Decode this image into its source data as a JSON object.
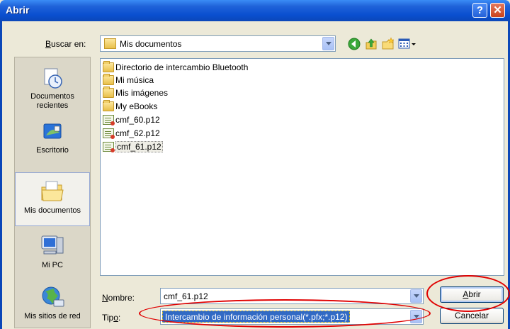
{
  "window": {
    "title": "Abrir",
    "help_glyph": "?",
    "close_glyph": "✕"
  },
  "look_in": {
    "label_prefix": "B",
    "label_rest": "uscar en:",
    "value": "Mis documentos"
  },
  "places": [
    {
      "label_line1": "Documentos",
      "label_line2": "recientes",
      "icon": "recent-documents-icon"
    },
    {
      "label_line1": "Escritorio",
      "label_line2": "",
      "icon": "desktop-icon"
    },
    {
      "label_line1": "Mis documentos",
      "label_line2": "",
      "icon": "my-documents-icon",
      "selected": true
    },
    {
      "label_line1": "Mi PC",
      "label_line2": "",
      "icon": "my-computer-icon"
    },
    {
      "label_line1": "Mis sitios de red",
      "label_line2": "",
      "icon": "network-places-icon"
    }
  ],
  "files": [
    {
      "name": "Directorio de intercambio Bluetooth",
      "icon": "folder-icon"
    },
    {
      "name": "Mi música",
      "icon": "music-folder-icon"
    },
    {
      "name": "Mis imágenes",
      "icon": "pictures-folder-icon"
    },
    {
      "name": "My eBooks",
      "icon": "folder-icon"
    },
    {
      "name": "cmf_60.p12",
      "icon": "certificate-file-icon"
    },
    {
      "name": "cmf_62.p12",
      "icon": "certificate-file-icon"
    },
    {
      "name": "cmf_61.p12",
      "icon": "certificate-file-icon",
      "selected": true
    }
  ],
  "filename": {
    "label_prefix": "N",
    "label_rest": "ombre:",
    "value": "cmf_61.p12"
  },
  "filetype": {
    "label_prefix": "Tip",
    "label_underlined": "o",
    "label_suffix": ":",
    "value": "Intercambio de información personal(*.pfx;*.p12)"
  },
  "buttons": {
    "open_prefix": "A",
    "open_rest": "brir",
    "cancel": "Cancelar"
  },
  "colors": {
    "titlebar": "#0b47b8",
    "highlight": "#316ac5",
    "annotation": "#e00000"
  }
}
